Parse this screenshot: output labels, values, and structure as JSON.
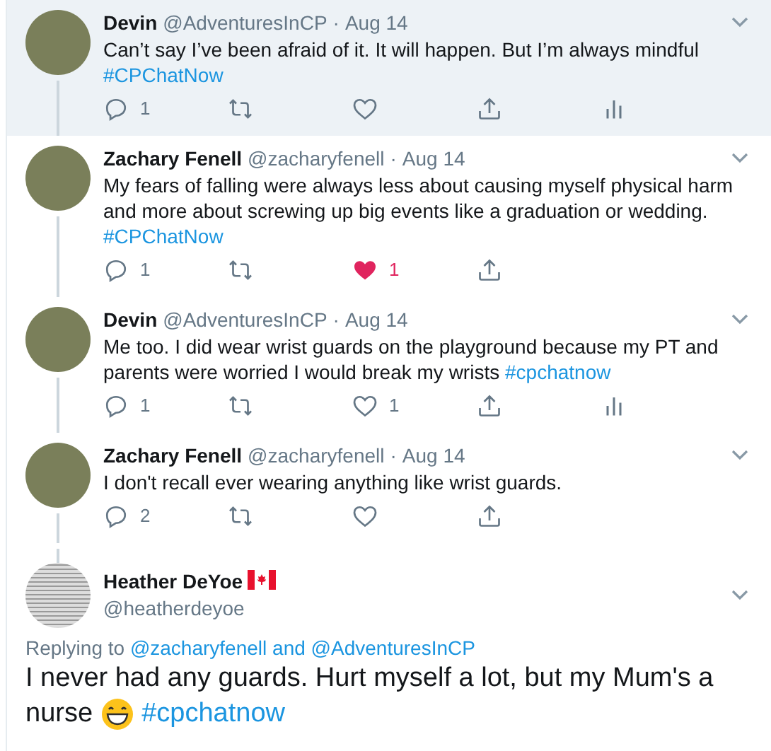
{
  "replies": [
    {
      "name": "Devin",
      "handle": "@AdventuresInCP",
      "separator": "·",
      "date": "Aug 14",
      "highlighted": true,
      "text": "Can’t say I’ve been afraid of it. It will happen. But I’m always mindful ",
      "hashtag": "#CPChatNow",
      "reply_count": "1",
      "liked": false,
      "analytics": true
    },
    {
      "name": "Zachary Fenell",
      "handle": "@zacharyfenell",
      "separator": "·",
      "date": "Aug 14",
      "highlighted": false,
      "text": "My fears of falling were always less about causing myself physical harm and more about screwing up big events like a graduation or wedding. ",
      "hashtag": "#CPChatNow",
      "reply_count": "1",
      "like_count": "1",
      "liked": true,
      "analytics": false
    },
    {
      "name": "Devin",
      "handle": "@AdventuresInCP",
      "separator": "·",
      "date": "Aug 14",
      "highlighted": false,
      "text": "Me too. I did wear wrist guards on the playground because my PT and parents were worried I would break my wrists ",
      "hashtag": "#cpchatnow",
      "reply_count": "1",
      "like_count": "1",
      "liked": false,
      "analytics": true
    },
    {
      "name": "Zachary Fenell",
      "handle": "@zacharyfenell",
      "separator": "·",
      "date": "Aug 14",
      "highlighted": false,
      "text": "I don't recall ever wearing anything like wrist guards.",
      "reply_count": "2",
      "liked": false,
      "analytics": false
    }
  ],
  "main_tweet": {
    "name": "Heather DeYoe",
    "handle": "@heatherdeyoe",
    "replying_label": "Replying to",
    "mentions": [
      "@zacharyfenell",
      "@AdventuresInCP"
    ],
    "mention_joiner": "and",
    "text": "I never had any guards. Hurt myself a lot, but my Mum's a nurse",
    "hashtag": "#cpchatnow"
  }
}
